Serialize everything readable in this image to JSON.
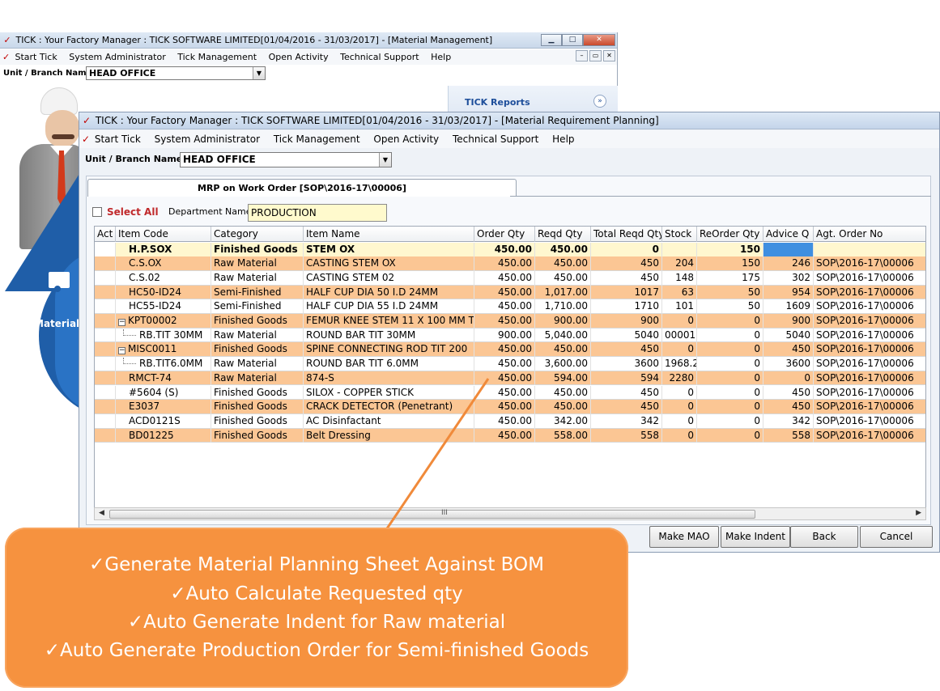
{
  "back_window": {
    "title": "TICK : Your Factory Manager : TICK SOFTWARE LIMITED[01/04/2016 - 31/03/2017] - [Material Management]",
    "menu": [
      "Start Tick",
      "System Administrator",
      "Tick Management",
      "Open Activity",
      "Technical Support",
      "Help"
    ],
    "unit_label": "Unit / Branch Name :",
    "unit_value": "HEAD OFFICE",
    "reports_label": "TICK Reports",
    "material_label": "Material D"
  },
  "front_window": {
    "title": "TICK : Your Factory Manager : TICK SOFTWARE LIMITED[01/04/2016 - 31/03/2017] - [Material Requirement Planning]",
    "menu": [
      "Start Tick",
      "System Administrator",
      "Tick Management",
      "Open Activity",
      "Technical Support",
      "Help"
    ],
    "unit_label": "Unit / Branch Name :",
    "unit_value": "HEAD OFFICE",
    "tab_label": "MRP on Work Order [SOP\\2016-17\\00006]",
    "select_all_label": "Select All",
    "department_label": "Department Name",
    "department_value": "PRODUCTION",
    "scroll_grip": "III",
    "buttons": {
      "make_mao": "Make MAO",
      "make_indent": "Make Indent",
      "back": "Back",
      "cancel": "Cancel"
    }
  },
  "grid": {
    "columns": [
      "Act",
      "Item Code",
      "Category",
      "Item Name",
      "Order Qty",
      "Reqd Qty",
      "Total Reqd Qty",
      "Stock",
      "ReOrder Qty",
      "Advice Q",
      "Agt. Order No"
    ],
    "rows": [
      {
        "code": "H.P.SOX",
        "category": "Finished Goods",
        "name": "STEM OX",
        "order": "450.00",
        "reqd": "450.00",
        "total": "0",
        "stock": "",
        "reorder": "150",
        "advice": "",
        "agt": "",
        "style": "first",
        "tree": "none"
      },
      {
        "code": "C.S.OX",
        "category": "Raw Material",
        "name": "CASTING STEM OX",
        "order": "450.00",
        "reqd": "450.00",
        "total": "450",
        "stock": "204",
        "reorder": "150",
        "advice": "246",
        "agt": "SOP\\2016-17\\00006",
        "style": "orange",
        "tree": "none"
      },
      {
        "code": "C.S.02",
        "category": "Raw Material",
        "name": "CASTING STEM 02",
        "order": "450.00",
        "reqd": "450.00",
        "total": "450",
        "stock": "148",
        "reorder": "175",
        "advice": "302",
        "agt": "SOP\\2016-17\\00006",
        "style": "white",
        "tree": "none"
      },
      {
        "code": "HC50-ID24",
        "category": "Semi-Finished",
        "name": "HALF CUP DIA 50 I.D 24MM",
        "order": "450.00",
        "reqd": "1,017.00",
        "total": "1017",
        "stock": "63",
        "reorder": "50",
        "advice": "954",
        "agt": "SOP\\2016-17\\00006",
        "style": "orange",
        "tree": "none"
      },
      {
        "code": "HC55-ID24",
        "category": "Semi-Finished",
        "name": "HALF CUP DIA 55 I.D 24MM",
        "order": "450.00",
        "reqd": "1,710.00",
        "total": "1710",
        "stock": "101",
        "reorder": "50",
        "advice": "1609",
        "agt": "SOP\\2016-17\\00006",
        "style": "white",
        "tree": "none"
      },
      {
        "code": "KPT00002",
        "category": "Finished Goods",
        "name": "FEMUR KNEE STEM 11 X 100 MM T",
        "order": "450.00",
        "reqd": "900.00",
        "total": "900",
        "stock": "0",
        "reorder": "0",
        "advice": "900",
        "agt": "SOP\\2016-17\\00006",
        "style": "orange",
        "tree": "parent"
      },
      {
        "code": "RB.TIT 30MM",
        "category": "Raw Material",
        "name": "ROUND BAR TIT 30MM",
        "order": "900.00",
        "reqd": "5,040.00",
        "total": "5040",
        "stock": "00001",
        "reorder": "0",
        "advice": "5040",
        "agt": "SOP\\2016-17\\00006",
        "style": "white",
        "tree": "child"
      },
      {
        "code": "MISC0011",
        "category": "Finished Goods",
        "name": "SPINE CONNECTING ROD TIT 200",
        "order": "450.00",
        "reqd": "450.00",
        "total": "450",
        "stock": "0",
        "reorder": "0",
        "advice": "450",
        "agt": "SOP\\2016-17\\00006",
        "style": "orange",
        "tree": "parent"
      },
      {
        "code": "RB.TIT6.0MM",
        "category": "Raw Material",
        "name": "ROUND BAR TIT 6.0MM",
        "order": "450.00",
        "reqd": "3,600.00",
        "total": "3600",
        "stock": "1968.2",
        "reorder": "0",
        "advice": "3600",
        "agt": "SOP\\2016-17\\00006",
        "style": "white",
        "tree": "child"
      },
      {
        "code": "RMCT-74",
        "category": "Raw Material",
        "name": "874-S",
        "order": "450.00",
        "reqd": "594.00",
        "total": "594",
        "stock": "2280",
        "reorder": "0",
        "advice": "0",
        "agt": "SOP\\2016-17\\00006",
        "style": "orange",
        "tree": "none"
      },
      {
        "code": "#5604 (S)",
        "category": "Finished Goods",
        "name": "SILOX - COPPER STICK",
        "order": "450.00",
        "reqd": "450.00",
        "total": "450",
        "stock": "0",
        "reorder": "0",
        "advice": "450",
        "agt": "SOP\\2016-17\\00006",
        "style": "white",
        "tree": "none"
      },
      {
        "code": "E3037",
        "category": "Finished Goods",
        "name": "CRACK DETECTOR (Penetrant)",
        "order": "450.00",
        "reqd": "450.00",
        "total": "450",
        "stock": "0",
        "reorder": "0",
        "advice": "450",
        "agt": "SOP\\2016-17\\00006",
        "style": "orange",
        "tree": "none"
      },
      {
        "code": "ACD0121S",
        "category": "Finished Goods",
        "name": "AC Disinfactant",
        "order": "450.00",
        "reqd": "342.00",
        "total": "342",
        "stock": "0",
        "reorder": "0",
        "advice": "342",
        "agt": "SOP\\2016-17\\00006",
        "style": "white",
        "tree": "none"
      },
      {
        "code": "BD01225",
        "category": "Finished Goods",
        "name": "Belt Dressing",
        "order": "450.00",
        "reqd": "558.00",
        "total": "558",
        "stock": "0",
        "reorder": "0",
        "advice": "558",
        "agt": "SOP\\2016-17\\00006",
        "style": "orange",
        "tree": "none"
      }
    ]
  },
  "callout": {
    "lines": [
      "✓Generate Material Planning Sheet Against BOM",
      "✓Auto Calculate Requested qty",
      "✓Auto Generate Indent for Raw material",
      "✓Auto Generate Production Order for Semi-finished Goods"
    ]
  },
  "colors": {
    "row_orange": "#fbc694",
    "callout_orange": "#f6923f",
    "accent_blue": "#1f5ea8",
    "select_all_red": "#c0292b"
  },
  "icons": [
    "tick-logo-icon",
    "minimize-icon",
    "maximize-icon",
    "close-icon",
    "chevron-down-icon",
    "dropdown-arrow-icon",
    "tree-expander-icon",
    "scroll-left-icon",
    "scroll-right-icon"
  ]
}
